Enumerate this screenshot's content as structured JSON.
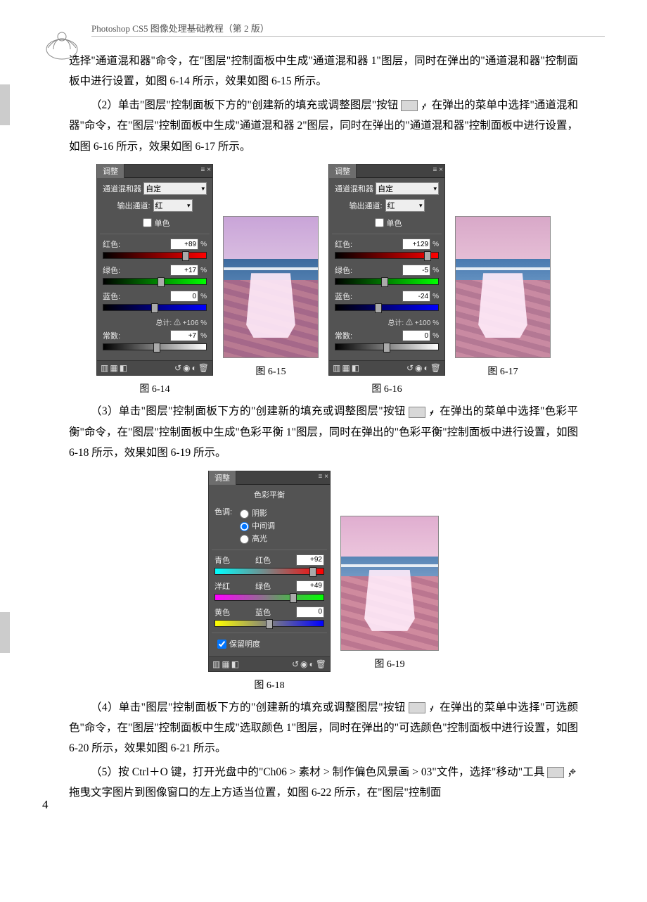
{
  "header": "Photoshop CS5 图像处理基础教程（第 2 版）",
  "pagenum": "4",
  "para1": "选择\"通道混和器\"命令，在\"图层\"控制面板中生成\"通道混和器 1\"图层，同时在弹出的\"通道混和器\"控制面板中进行设置，如图 6-14 所示，效果如图 6-15 所示。",
  "para2a": "（2）单击\"图层\"控制面板下方的\"创建新的填充或调整图层\"按钮",
  "para2b": "，在弹出的菜单中选择\"通道混和器\"命令，在\"图层\"控制面板中生成\"通道混和器 2\"图层，同时在弹出的\"通道混和器\"控制面板中进行设置，如图 6-16 所示，效果如图 6-17 所示。",
  "para3a": "（3）单击\"图层\"控制面板下方的\"创建新的填充或调整图层\"按钮",
  "para3b": "，在弹出的菜单中选择\"色彩平衡\"命令，在\"图层\"控制面板中生成\"色彩平衡 1\"图层，同时在弹出的\"色彩平衡\"控制面板中进行设置，如图 6-18 所示，效果如图 6-19 所示。",
  "para4a": "（4）单击\"图层\"控制面板下方的\"创建新的填充或调整图层\"按钮",
  "para4b": "，在弹出的菜单中选择\"可选颜色\"命令，在\"图层\"控制面板中生成\"选取颜色 1\"图层，同时在弹出的\"可选颜色\"控制面板中进行设置，如图 6-20 所示，效果如图 6-21 所示。",
  "para5a": "（5）按 Ctrl＋O 键，打开光盘中的\"Ch06 > 素材 > 制作偏色风景画 > 03\"文件，选择\"移动\"工具",
  "para5b": "，拖曳文字图片到图像窗口的左上方适当位置，如图 6-22 所示，在\"图层\"控制面",
  "captions": {
    "c614": "图 6-14",
    "c615": "图 6-15",
    "c616": "图 6-16",
    "c617": "图 6-17",
    "c618": "图 6-18",
    "c619": "图 6-19"
  },
  "panel_tab": "调整",
  "panel614": {
    "title": "通道混和器",
    "preset": "自定",
    "outlabel": "输出通道:",
    "outval": "红",
    "mono": "单色",
    "r_label": "红色:",
    "r_val": "+89",
    "g_label": "绿色:",
    "g_val": "+17",
    "b_label": "蓝色:",
    "b_val": "0",
    "total_label": "总计:",
    "total_val": "+106",
    "const_label": "常数:",
    "const_val": "+7",
    "pct": "%"
  },
  "panel616": {
    "title": "通道混和器",
    "preset": "自定",
    "outlabel": "输出通道:",
    "outval": "红",
    "mono": "单色",
    "r_label": "红色:",
    "r_val": "+129",
    "g_label": "绿色:",
    "g_val": "-5",
    "b_label": "蓝色:",
    "b_val": "-24",
    "total_label": "总计:",
    "total_val": "+100",
    "const_label": "常数:",
    "const_val": "0",
    "pct": "%"
  },
  "panel618": {
    "title": "色彩平衡",
    "tone_label": "色调:",
    "opt_shadow": "阴影",
    "opt_mid": "中间调",
    "opt_high": "高光",
    "pair1_l": "青色",
    "pair1_r": "红色",
    "pair1_val": "+92",
    "pair2_l": "洋红",
    "pair2_r": "绿色",
    "pair2_val": "+49",
    "pair3_l": "黄色",
    "pair3_r": "蓝色",
    "pair3_val": "0",
    "preserve": "保留明度"
  },
  "icon_adj": "◐",
  "icon_move": "✥"
}
